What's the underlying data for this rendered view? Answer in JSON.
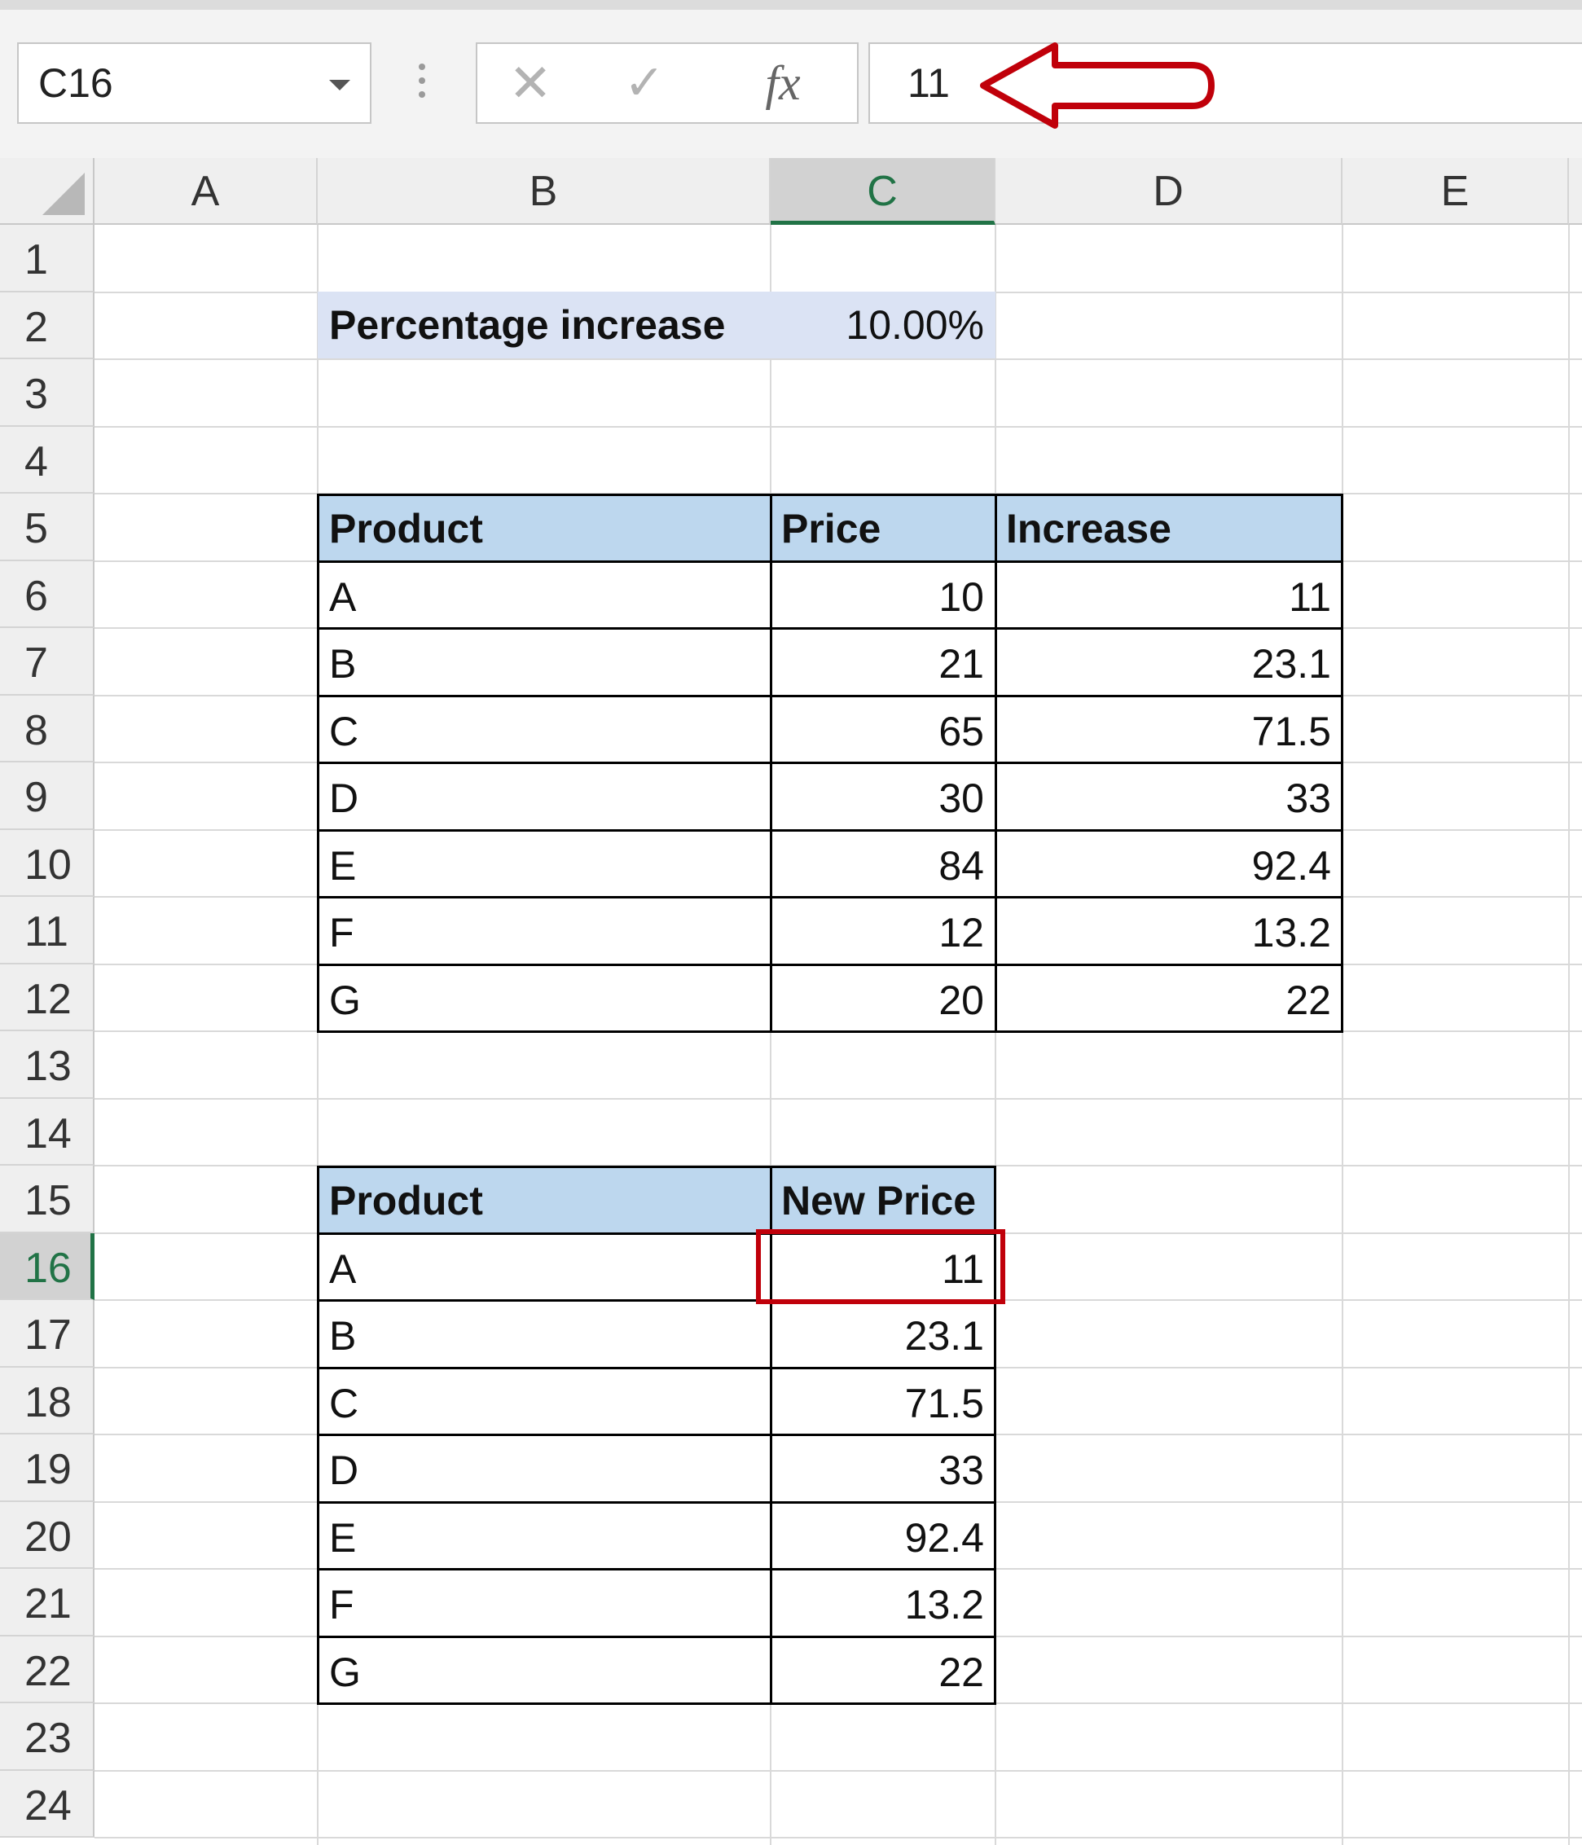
{
  "formula_bar": {
    "name_box": "C16",
    "formula_value": "11",
    "icons": [
      "cancel-x-icon",
      "enter-check-icon",
      "insert-function-fx-icon"
    ],
    "fx_label": "fx"
  },
  "columns": [
    "A",
    "B",
    "C",
    "D",
    "E"
  ],
  "selected_column": "C",
  "rows": [
    "1",
    "2",
    "3",
    "4",
    "5",
    "6",
    "7",
    "8",
    "9",
    "10",
    "11",
    "12",
    "13",
    "14",
    "15",
    "16",
    "17",
    "18",
    "19",
    "20",
    "21",
    "22",
    "23",
    "24"
  ],
  "selected_row": "16",
  "percentage": {
    "label": "Percentage increase",
    "value": "10.00%"
  },
  "table1": {
    "headers": [
      "Product",
      "Price",
      "Increase"
    ],
    "rows": [
      [
        "A",
        "10",
        "11"
      ],
      [
        "B",
        "21",
        "23.1"
      ],
      [
        "C",
        "65",
        "71.5"
      ],
      [
        "D",
        "30",
        "33"
      ],
      [
        "E",
        "84",
        "92.4"
      ],
      [
        "F",
        "12",
        "13.2"
      ],
      [
        "G",
        "20",
        "22"
      ]
    ]
  },
  "table2": {
    "headers": [
      "Product",
      "New Price"
    ],
    "rows": [
      [
        "A",
        "11"
      ],
      [
        "B",
        "23.1"
      ],
      [
        "C",
        "71.5"
      ],
      [
        "D",
        "33"
      ],
      [
        "E",
        "92.4"
      ],
      [
        "F",
        "13.2"
      ],
      [
        "G",
        "22"
      ]
    ]
  },
  "colors": {
    "accent_green": "#217346",
    "annotation_red": "#c0000a",
    "header_fill": "#bdd7ee",
    "percentage_fill": "#dbe3f4"
  }
}
